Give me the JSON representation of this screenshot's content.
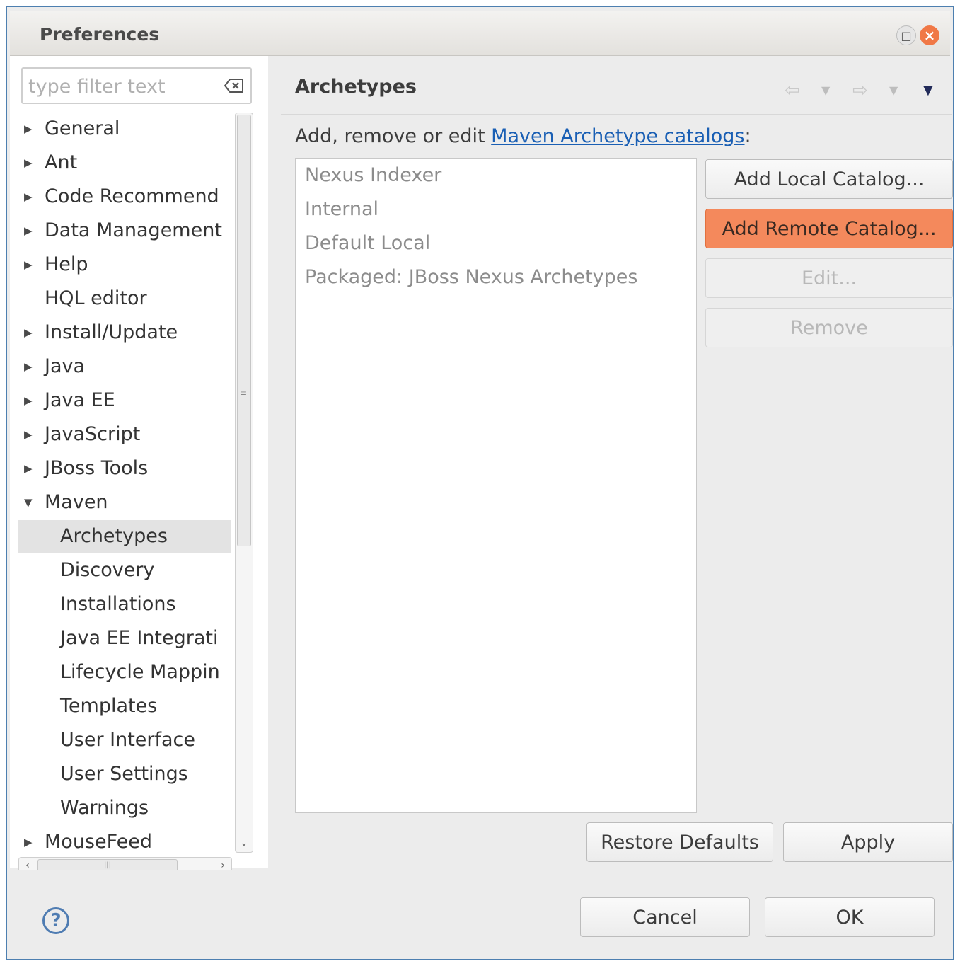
{
  "window": {
    "title": "Preferences"
  },
  "filter": {
    "placeholder": "type filter text"
  },
  "tree": {
    "items": [
      {
        "label": "General",
        "expandable": true
      },
      {
        "label": "Ant",
        "expandable": true
      },
      {
        "label": "Code Recommend",
        "expandable": true
      },
      {
        "label": "Data Management",
        "expandable": true
      },
      {
        "label": "Help",
        "expandable": true
      },
      {
        "label": "HQL editor",
        "expandable": false
      },
      {
        "label": "Install/Update",
        "expandable": true
      },
      {
        "label": "Java",
        "expandable": true
      },
      {
        "label": "Java EE",
        "expandable": true
      },
      {
        "label": "JavaScript",
        "expandable": true
      },
      {
        "label": "JBoss Tools",
        "expandable": true
      },
      {
        "label": "Maven",
        "expandable": true,
        "expanded": true
      },
      {
        "label": "Archetypes",
        "child": true,
        "selected": true
      },
      {
        "label": "Discovery",
        "child": true
      },
      {
        "label": "Installations",
        "child": true
      },
      {
        "label": "Java EE Integrati",
        "child": true
      },
      {
        "label": "Lifecycle Mappin",
        "child": true
      },
      {
        "label": "Templates",
        "child": true
      },
      {
        "label": "User Interface",
        "child": true
      },
      {
        "label": "User Settings",
        "child": true
      },
      {
        "label": "Warnings",
        "child": true
      },
      {
        "label": "MouseFeed",
        "expandable": true
      }
    ]
  },
  "page": {
    "title": "Archetypes",
    "description_prefix": "Add, remove or edit ",
    "description_link": "Maven Archetype catalogs",
    "description_suffix": ":",
    "catalogs": [
      "Nexus Indexer",
      "Internal",
      "Default Local",
      "Packaged: JBoss Nexus Archetypes"
    ],
    "buttons": {
      "add_local": "Add Local Catalog...",
      "add_remote": "Add Remote Catalog...",
      "edit": "Edit...",
      "remove": "Remove",
      "restore_defaults": "Restore Defaults",
      "apply": "Apply"
    }
  },
  "dialog_buttons": {
    "cancel": "Cancel",
    "ok": "OK"
  },
  "colors": {
    "accent_button": "#f4895c",
    "link": "#1a5fb4",
    "close_button": "#f07846"
  }
}
